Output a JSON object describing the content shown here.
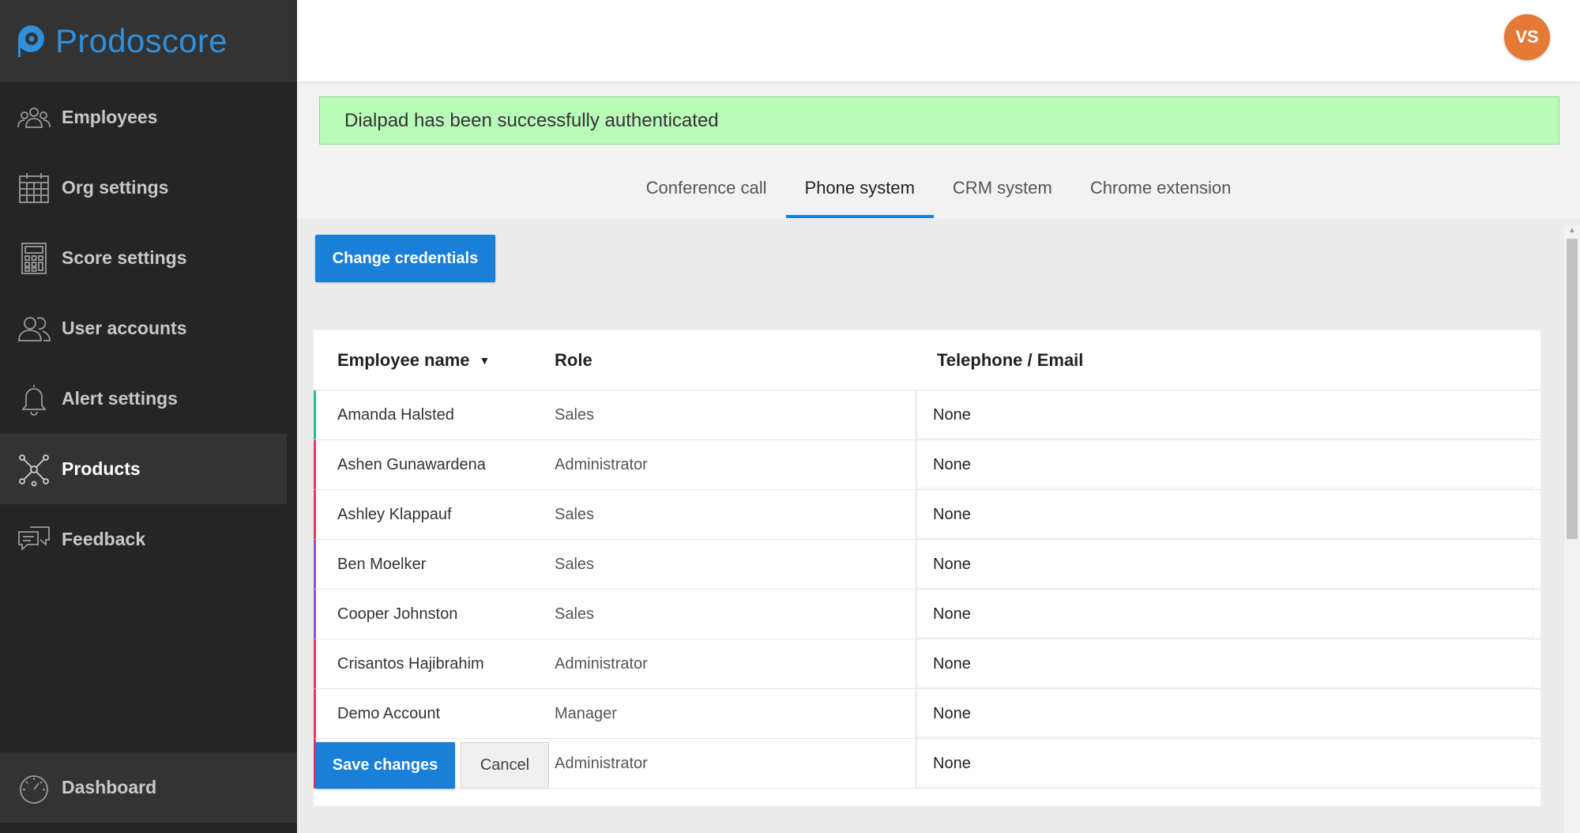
{
  "brand": {
    "name": "Prodoscore",
    "color": "#2e8fdc"
  },
  "sidebar": {
    "items": [
      {
        "label": "Employees",
        "icon": "employees-icon",
        "active": false
      },
      {
        "label": "Org settings",
        "icon": "calendar-icon",
        "active": false
      },
      {
        "label": "Score settings",
        "icon": "calculator-icon",
        "active": false
      },
      {
        "label": "User accounts",
        "icon": "users-icon",
        "active": false
      },
      {
        "label": "Alert settings",
        "icon": "bell-icon",
        "active": false
      },
      {
        "label": "Products",
        "icon": "network-icon",
        "active": true
      },
      {
        "label": "Feedback",
        "icon": "chat-icon",
        "active": false
      }
    ],
    "bottom": {
      "label": "Dashboard",
      "icon": "gauge-icon"
    }
  },
  "header": {
    "avatar_initials": "VS",
    "avatar_color": "#e47a36"
  },
  "alert": {
    "message": "Dialpad has been successfully authenticated",
    "color": "#b9fbb9"
  },
  "tabs": [
    {
      "label": "Conference call",
      "active": false
    },
    {
      "label": "Phone system",
      "active": true
    },
    {
      "label": "CRM system",
      "active": false
    },
    {
      "label": "Chrome extension",
      "active": false
    }
  ],
  "actions": {
    "change_credentials": "Change credentials",
    "save_changes": "Save changes",
    "cancel": "Cancel"
  },
  "table": {
    "columns": {
      "name": "Employee name",
      "role": "Role",
      "telephone": "Telephone / Email"
    },
    "sort_indicator": "▼",
    "rows": [
      {
        "name": "Amanda Halsted",
        "role": "Sales",
        "telephone": "None",
        "accent": "#25c18a"
      },
      {
        "name": "Ashen Gunawardena",
        "role": "Administrator",
        "telephone": "None",
        "accent": "#e5385a"
      },
      {
        "name": "Ashley Klappauf",
        "role": "Sales",
        "telephone": "None",
        "accent": "#e5385a"
      },
      {
        "name": "Ben Moelker",
        "role": "Sales",
        "telephone": "None",
        "accent": "#8c52d6"
      },
      {
        "name": "Cooper Johnston",
        "role": "Sales",
        "telephone": "None",
        "accent": "#8c52d6"
      },
      {
        "name": "Crisantos Hajibrahim",
        "role": "Administrator",
        "telephone": "None",
        "accent": "#e5385a"
      },
      {
        "name": "Demo Account",
        "role": "Manager",
        "telephone": "None",
        "accent": "#e5385a"
      },
      {
        "name": "",
        "role": "Administrator",
        "telephone": "None",
        "accent": "#e5385a"
      }
    ]
  }
}
